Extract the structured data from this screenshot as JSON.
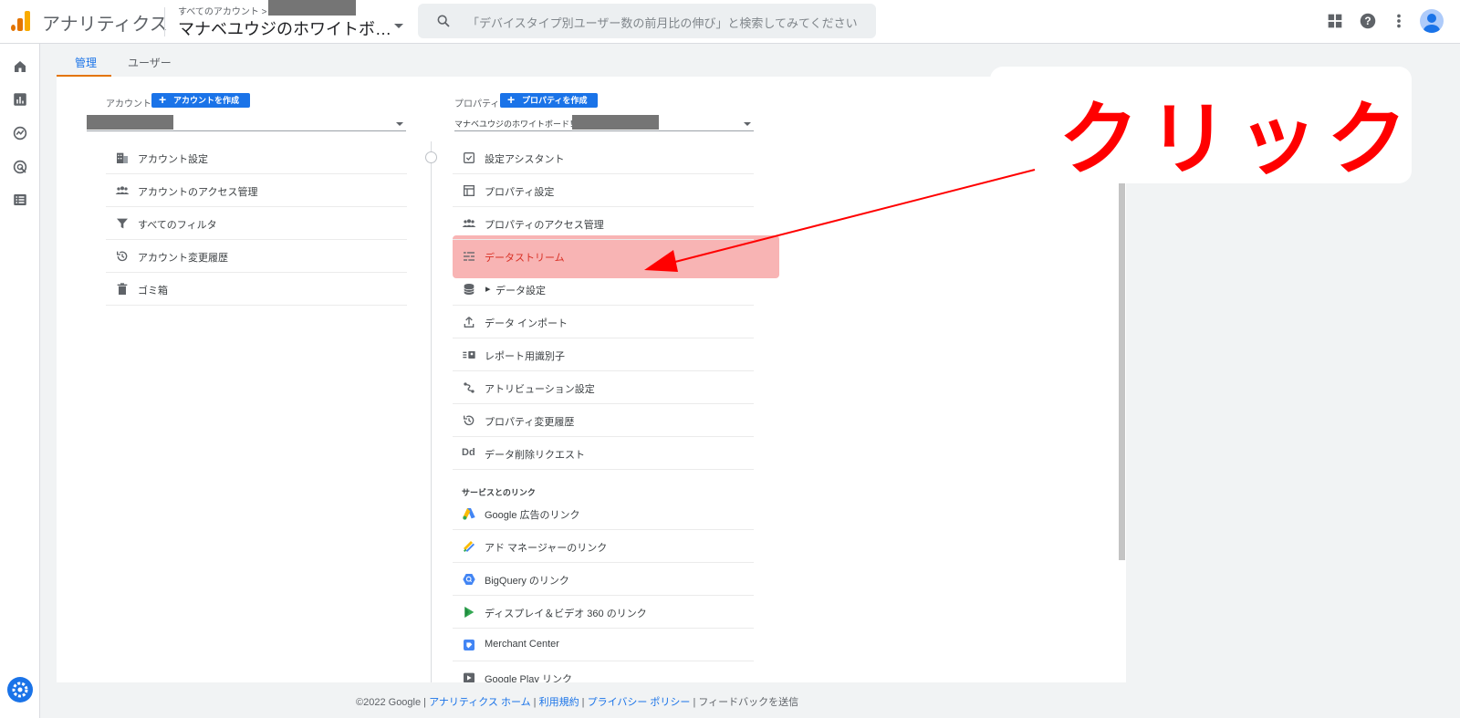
{
  "header": {
    "app_title": "アナリティクス",
    "breadcrumb": "すべてのアカウント >",
    "property_title": "マナベユウジのホワイトボ…",
    "search_placeholder": "「デバイスタイプ別ユーザー数の前月比の伸び」と検索してみてください"
  },
  "tabs": [
    {
      "label": "管理",
      "active": true
    },
    {
      "label": "ユーザー",
      "active": false
    }
  ],
  "account_column": {
    "label": "アカウント",
    "create_button": "アカウントを作成",
    "items": [
      {
        "label": "アカウント設定",
        "icon": "building-icon"
      },
      {
        "label": "アカウントのアクセス管理",
        "icon": "people-icon"
      },
      {
        "label": "すべてのフィルタ",
        "icon": "filter-icon"
      },
      {
        "label": "アカウント変更履歴",
        "icon": "history-icon"
      },
      {
        "label": "ゴミ箱",
        "icon": "trash-icon"
      }
    ]
  },
  "property_column": {
    "label": "プロパティ",
    "create_button": "プロパティを作成",
    "selected_property": "マナベユウジのホワイトボード！",
    "items": [
      {
        "label": "設定アシスタント",
        "icon": "checkbox-icon"
      },
      {
        "label": "プロパティ設定",
        "icon": "layout-icon"
      },
      {
        "label": "プロパティのアクセス管理",
        "icon": "people-icon"
      },
      {
        "label": "データストリーム",
        "icon": "stream-icon",
        "highlighted": true
      },
      {
        "label": "データ設定",
        "icon": "database-icon"
      },
      {
        "label": "データ インポート",
        "icon": "upload-icon"
      },
      {
        "label": "レポート用識別子",
        "icon": "identity-icon"
      },
      {
        "label": "アトリビューション設定",
        "icon": "attribution-icon"
      },
      {
        "label": "プロパティ変更履歴",
        "icon": "history-icon"
      },
      {
        "label": "データ削除リクエスト",
        "icon": "dd-icon"
      }
    ],
    "links_section_title": "サービスとのリンク",
    "links": [
      {
        "label": "Google 広告のリンク",
        "icon": "google-ads-icon"
      },
      {
        "label": "アド マネージャーのリンク",
        "icon": "ad-manager-icon"
      },
      {
        "label": "BigQuery のリンク",
        "icon": "bigquery-icon"
      },
      {
        "label": "ディスプレイ＆ビデオ 360 のリンク",
        "icon": "dv360-icon"
      },
      {
        "label": "Merchant Center",
        "icon": "merchant-center-icon"
      },
      {
        "label": "Google Play リンク",
        "icon": "google-play-icon"
      }
    ]
  },
  "annotation": {
    "text": "クリック"
  },
  "footer": {
    "copyright": "©2022 Google |",
    "links": [
      "アナリティクス ホーム",
      "利用規約",
      "プライバシー ポリシー"
    ],
    "feedback": "フィードバックを送信"
  },
  "colors": {
    "accent_blue": "#1a73e8",
    "annotation_red": "#ff0000",
    "highlight_pink": "#f8b4b4",
    "tab_underline": "#e37400"
  }
}
